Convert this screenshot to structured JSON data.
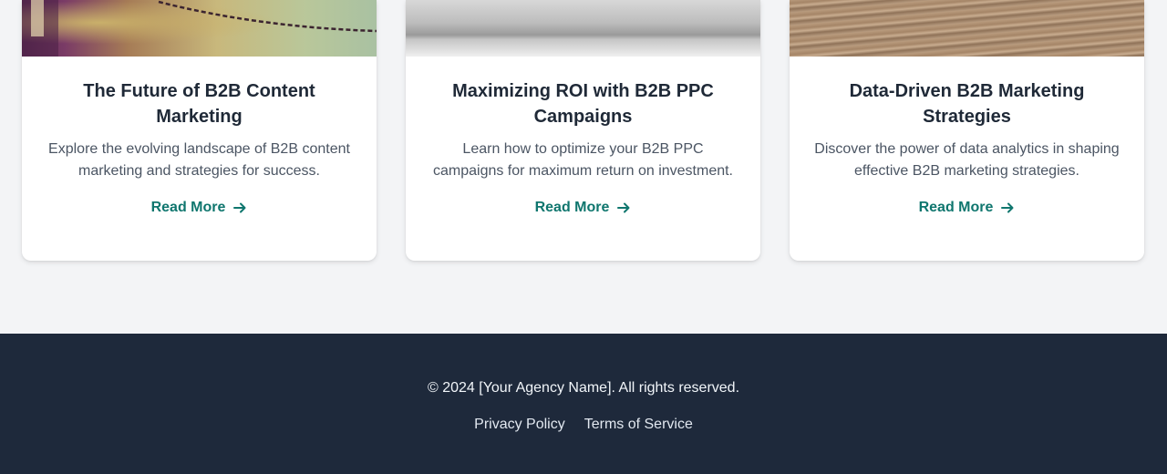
{
  "cards": [
    {
      "title": "The Future of B2B Content Marketing",
      "description": "Explore the evolving landscape of B2B content marketing and strategies for success.",
      "link_label": "Read More",
      "link_icon": "arrow-right-icon"
    },
    {
      "title": "Maximizing ROI with B2B PPC Campaigns",
      "description": "Learn how to optimize your B2B PPC campaigns for maximum return on investment.",
      "link_label": "Read More",
      "link_icon": "arrow-right-icon"
    },
    {
      "title": "Data-Driven B2B Marketing Strategies",
      "description": "Discover the power of data analytics in shaping effective B2B marketing strategies.",
      "link_label": "Read More",
      "link_icon": "arrow-right-icon"
    }
  ],
  "footer": {
    "copyright": "© 2024 [Your Agency Name]. All rights reserved.",
    "links": [
      "Privacy Policy",
      "Terms of Service"
    ]
  },
  "colors": {
    "accent": "#0f766e",
    "footer_bg": "#1e293b",
    "page_bg": "#f3f4f6"
  }
}
